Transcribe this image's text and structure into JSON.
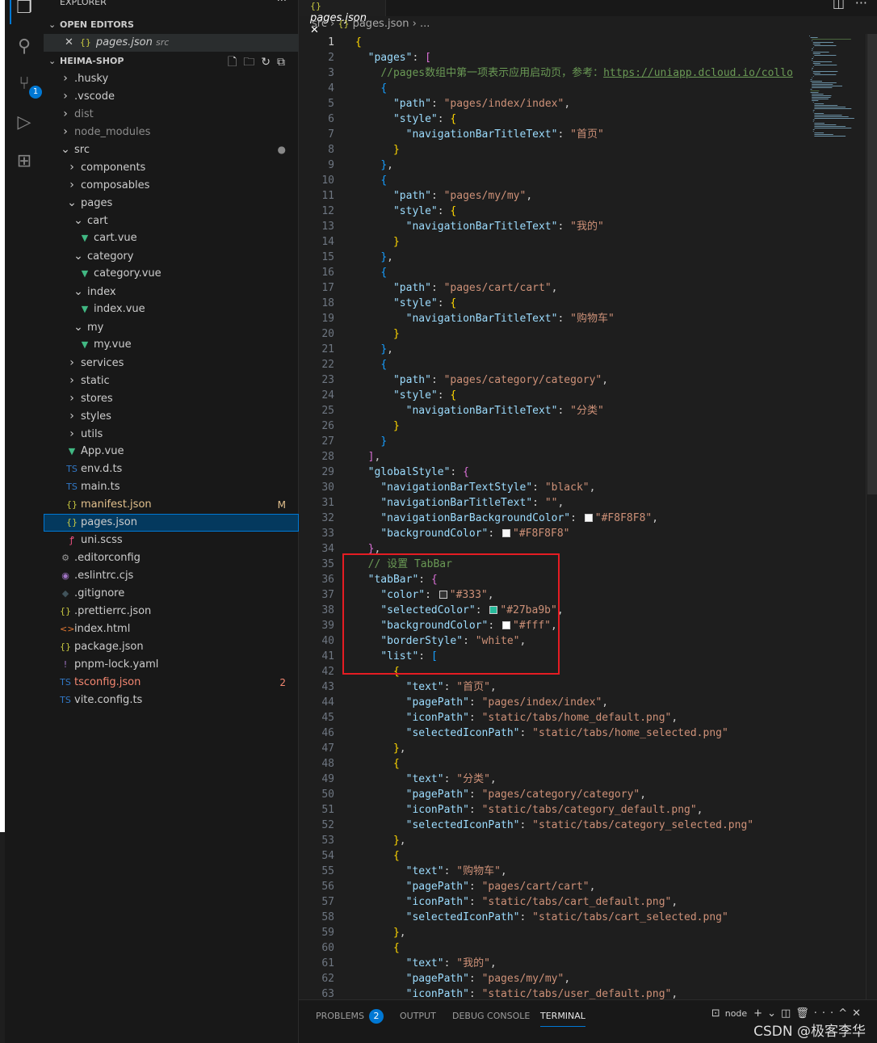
{
  "sidebar": {
    "title": "EXPLORER",
    "open_editors": "OPEN EDITORS",
    "open_file": "pages.json",
    "open_file_dir": "src",
    "project": "HEIMA-SHOP",
    "tree": [
      {
        "d": 0,
        "t": "folder",
        "open": false,
        "label": ".husky"
      },
      {
        "d": 0,
        "t": "folder",
        "open": false,
        "label": ".vscode"
      },
      {
        "d": 0,
        "t": "folder",
        "open": false,
        "label": "dist",
        "dim": true
      },
      {
        "d": 0,
        "t": "folder",
        "open": false,
        "label": "node_modules",
        "dim": true
      },
      {
        "d": 0,
        "t": "folder",
        "open": true,
        "label": "src",
        "dec": "●"
      },
      {
        "d": 1,
        "t": "folder",
        "open": false,
        "label": "components"
      },
      {
        "d": 1,
        "t": "folder",
        "open": false,
        "label": "composables"
      },
      {
        "d": 1,
        "t": "folder",
        "open": true,
        "label": "pages"
      },
      {
        "d": 2,
        "t": "folder",
        "open": true,
        "label": "cart"
      },
      {
        "d": 3,
        "t": "vue",
        "label": "cart.vue"
      },
      {
        "d": 2,
        "t": "folder",
        "open": true,
        "label": "category"
      },
      {
        "d": 3,
        "t": "vue",
        "label": "category.vue"
      },
      {
        "d": 2,
        "t": "folder",
        "open": true,
        "label": "index"
      },
      {
        "d": 3,
        "t": "vue",
        "label": "index.vue"
      },
      {
        "d": 2,
        "t": "folder",
        "open": true,
        "label": "my"
      },
      {
        "d": 3,
        "t": "vue",
        "label": "my.vue"
      },
      {
        "d": 1,
        "t": "folder",
        "open": false,
        "label": "services"
      },
      {
        "d": 1,
        "t": "folder",
        "open": false,
        "label": "static"
      },
      {
        "d": 1,
        "t": "folder",
        "open": false,
        "label": "stores"
      },
      {
        "d": 1,
        "t": "folder",
        "open": false,
        "label": "styles"
      },
      {
        "d": 1,
        "t": "folder",
        "open": false,
        "label": "utils"
      },
      {
        "d": 1,
        "t": "vue",
        "label": "App.vue"
      },
      {
        "d": 1,
        "t": "ts",
        "label": "env.d.ts"
      },
      {
        "d": 1,
        "t": "ts",
        "label": "main.ts"
      },
      {
        "d": 1,
        "t": "json",
        "label": "manifest.json",
        "dec": "M",
        "color": "#e2c08d"
      },
      {
        "d": 1,
        "t": "json",
        "label": "pages.json",
        "sel": true
      },
      {
        "d": 1,
        "t": "css",
        "label": "uni.scss"
      },
      {
        "d": 0,
        "t": "gear",
        "label": ".editorconfig"
      },
      {
        "d": 0,
        "t": "eslint",
        "label": ".eslintrc.cjs"
      },
      {
        "d": 0,
        "t": "git",
        "label": ".gitignore"
      },
      {
        "d": 0,
        "t": "json",
        "label": ".prettierrc.json"
      },
      {
        "d": 0,
        "t": "html",
        "label": "index.html"
      },
      {
        "d": 0,
        "t": "json",
        "label": "package.json"
      },
      {
        "d": 0,
        "t": "yaml",
        "label": "pnpm-lock.yaml"
      },
      {
        "d": 0,
        "t": "tsconfig",
        "label": "tsconfig.json",
        "dec": "2",
        "color": "#f48771"
      },
      {
        "d": 0,
        "t": "ts",
        "label": "vite.config.ts"
      }
    ]
  },
  "activity": {
    "scm_badge": "1"
  },
  "editor": {
    "tab": "pages.json",
    "breadcrumb": [
      "src",
      "pages.json",
      "..."
    ],
    "current_line": 1,
    "lines": [
      "{",
      "  \"pages\": [",
      "    //pages数组中第一项表示应用启动页，参考：https://uniapp.dcloud.io/collo",
      "    {",
      "      \"path\": \"pages/index/index\",",
      "      \"style\": {",
      "        \"navigationBarTitleText\": \"首页\"",
      "      }",
      "    },",
      "    {",
      "      \"path\": \"pages/my/my\",",
      "      \"style\": {",
      "        \"navigationBarTitleText\": \"我的\"",
      "      }",
      "    },",
      "    {",
      "      \"path\": \"pages/cart/cart\",",
      "      \"style\": {",
      "        \"navigationBarTitleText\": \"购物车\"",
      "      }",
      "    },",
      "    {",
      "      \"path\": \"pages/category/category\",",
      "      \"style\": {",
      "        \"navigationBarTitleText\": \"分类\"",
      "      }",
      "    }",
      "  ],",
      "  \"globalStyle\": {",
      "    \"navigationBarTextStyle\": \"black\",",
      "    \"navigationBarTitleText\": \"\",",
      "    \"navigationBarBackgroundColor\": \"#F8F8F8\",",
      "    \"backgroundColor\": \"#F8F8F8\"",
      "  },",
      "  // 设置 TabBar",
      "  \"tabBar\": {",
      "    \"color\": \"#333\",",
      "    \"selectedColor\": \"#27ba9b\",",
      "    \"backgroundColor\": \"#fff\",",
      "    \"borderStyle\": \"white\",",
      "    \"list\": [",
      "      {",
      "        \"text\": \"首页\",",
      "        \"pagePath\": \"pages/index/index\",",
      "        \"iconPath\": \"static/tabs/home_default.png\",",
      "        \"selectedIconPath\": \"static/tabs/home_selected.png\"",
      "      },",
      "      {",
      "        \"text\": \"分类\",",
      "        \"pagePath\": \"pages/category/category\",",
      "        \"iconPath\": \"static/tabs/category_default.png\",",
      "        \"selectedIconPath\": \"static/tabs/category_selected.png\"",
      "      },",
      "      {",
      "        \"text\": \"购物车\",",
      "        \"pagePath\": \"pages/cart/cart\",",
      "        \"iconPath\": \"static/tabs/cart_default.png\",",
      "        \"selectedIconPath\": \"static/tabs/cart_selected.png\"",
      "      },",
      "      {",
      "        \"text\": \"我的\",",
      "        \"pagePath\": \"pages/my/my\",",
      "        \"iconPath\": \"static/tabs/user_default.png\","
    ]
  },
  "panel": {
    "tabs": [
      "PROBLEMS",
      "OUTPUT",
      "DEBUG CONSOLE",
      "TERMINAL"
    ],
    "problems_count": "2",
    "active": "TERMINAL",
    "terminal": "node"
  },
  "watermark": "CSDN @极客李华",
  "colors": {
    "accent": "#0078d4",
    "highlight_box": "#e51c23"
  }
}
